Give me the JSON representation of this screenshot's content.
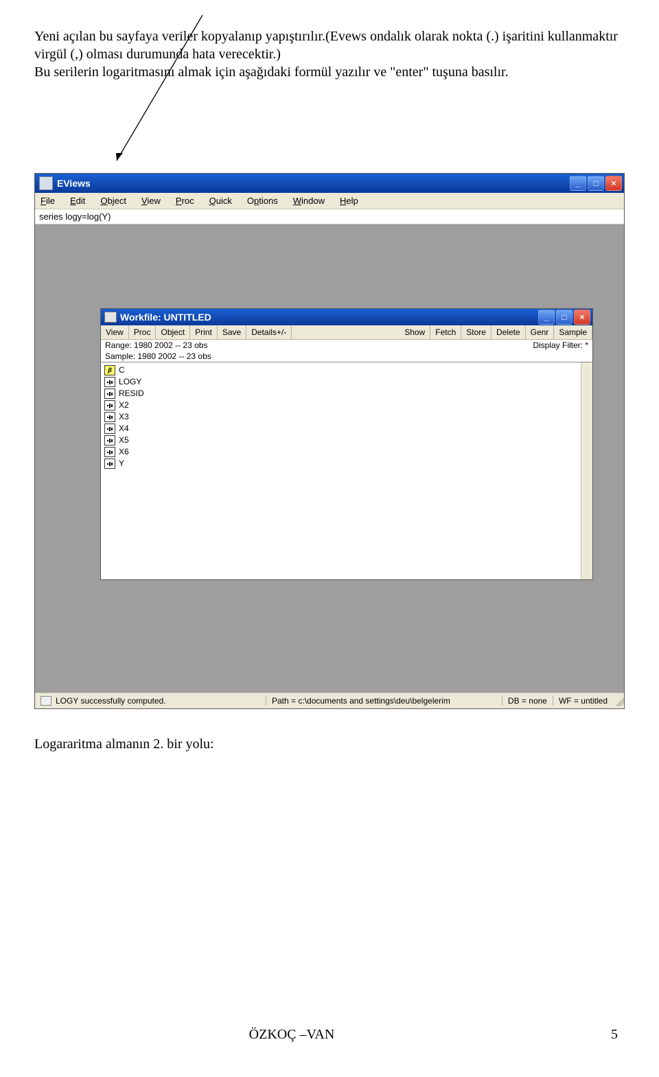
{
  "doc": {
    "intro": "Yeni açılan bu sayfaya veriler kopyalanıp yapıştırılır.(Evews ondalık olarak nokta (.) işaritini kullanmaktır virgül (,) olması durumunda hata verecektir.)",
    "intro2": "Bu serilerin logaritmasını almak için aşağıdaki formül yazılır ve \"enter\" tuşuna basılır.",
    "after": "Logararitma almanın 2. bir yolu:",
    "footer_center": "ÖZKOÇ –VAN",
    "footer_right": "5"
  },
  "app": {
    "title": "EViews",
    "menus": {
      "file": "File",
      "edit": "Edit",
      "object": "Object",
      "view": "View",
      "proc": "Proc",
      "quick": "Quick",
      "options": "Options",
      "window": "Window",
      "help": "Help"
    },
    "command": "series logy=log(Y)"
  },
  "workfile": {
    "title": "Workfile: UNTITLED",
    "toolbar": [
      "View",
      "Proc",
      "Object",
      "Print",
      "Save",
      "Details+/-",
      "Show",
      "Fetch",
      "Store",
      "Delete",
      "Genr",
      "Sample"
    ],
    "range": "Range: 1980 2002   --   23 obs",
    "sample": "Sample: 1980 2002   --   23 obs",
    "filter": "Display Filter: *",
    "series": [
      {
        "icon": "beta",
        "label": "C"
      },
      {
        "icon": "series",
        "label": "LOGY"
      },
      {
        "icon": "series",
        "label": "RESID"
      },
      {
        "icon": "series",
        "label": "X2"
      },
      {
        "icon": "series",
        "label": "X3"
      },
      {
        "icon": "series",
        "label": "X4"
      },
      {
        "icon": "series",
        "label": "X5"
      },
      {
        "icon": "series",
        "label": "X6"
      },
      {
        "icon": "series",
        "label": "Y"
      }
    ]
  },
  "status": {
    "msg": "LOGY successfully computed.",
    "path": "Path = c:\\documents and settings\\deu\\belgelerim",
    "db": "DB = none",
    "wf": "WF = untitled"
  }
}
